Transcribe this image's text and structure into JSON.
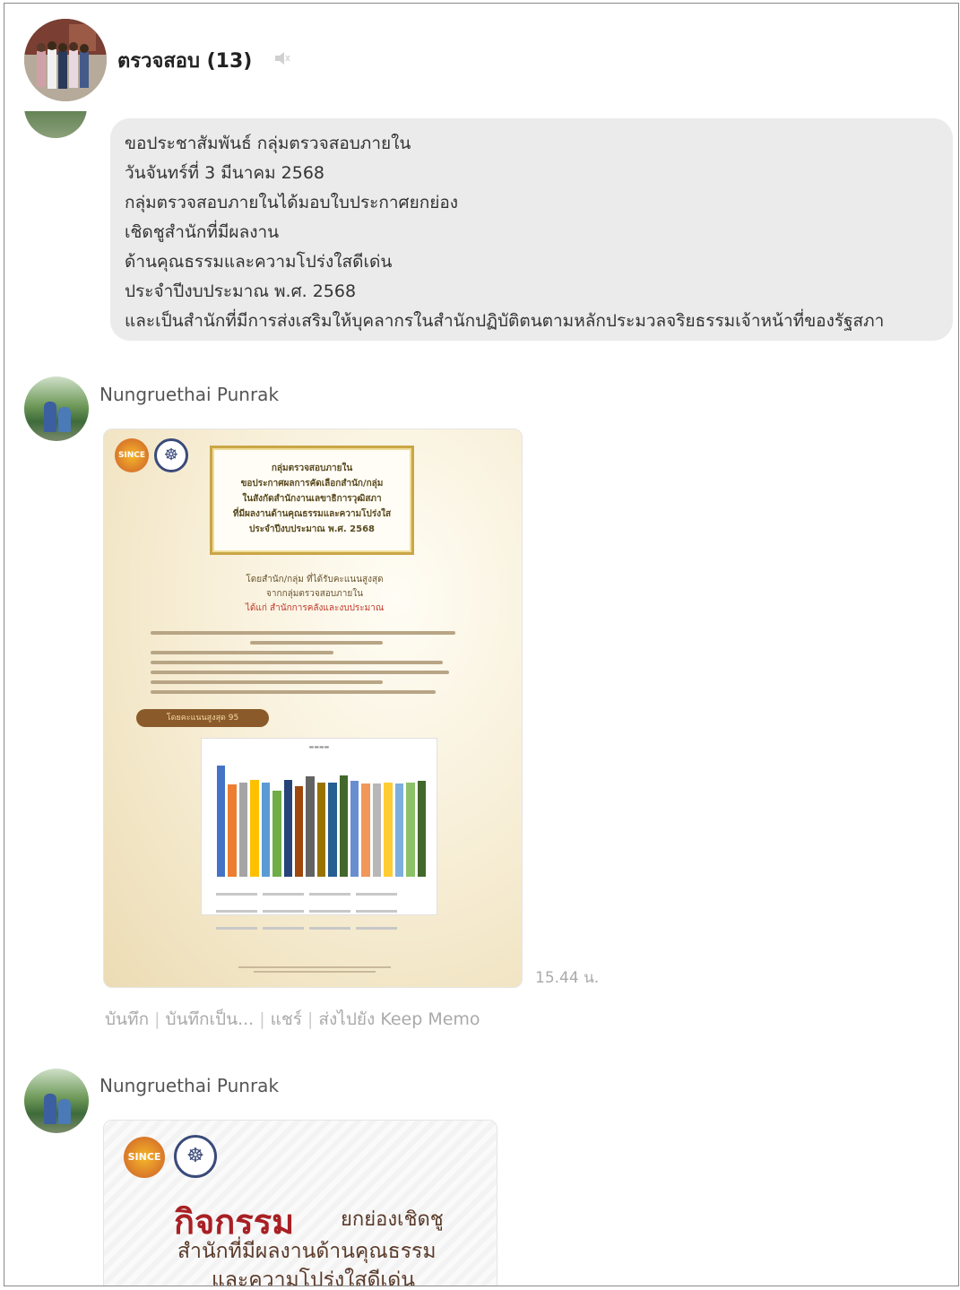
{
  "header": {
    "group_name": "ตรวจสอบ (13)"
  },
  "messages": [
    {
      "lines": [
        "ขอประชาสัมพันธ์  กลุ่มตรวจสอบภายใน",
        "วันจันทร์ที่ 3 มีนาคม 2568",
        "กลุ่มตรวจสอบภายในได้มอบใบประกาศยกย่อง",
        "เชิดชูสำนักที่มีผลงาน",
        "ด้านคุณธรรมและความโปร่งใสดีเด่น",
        "ประจำปีงบประมาณ พ.ศ. 2568",
        "และเป็นสำนักที่มีการส่งเสริมให้บุคลากรในสำนักปฏิบัติตนตามหลักประมวลจริยธรรมเจ้าหน้าที่ของรัฐสภา"
      ]
    },
    {
      "author": "Nungruethai Punrak",
      "timestamp": "15.44 น.",
      "poster": {
        "title_lines": [
          "กลุ่มตรวจสอบภายใน",
          "ขอประกาศผลการคัดเลือกสำนัก/กลุ่ม",
          "ในสังกัดสำนักงานเลขาธิการวุฒิสภา",
          "ที่มีผลงานด้านคุณธรรมและความโปร่งใส",
          "ประจำปีงบประมาณ พ.ศ. 2568"
        ],
        "sub_lines": [
          "โดยสำนัก/กลุ่ม ที่ได้รับคะแนนสูงสุด",
          "จากกลุ่มตรวจสอบภายใน",
          "ได้แก่ สำนักการคลังและงบประมาณ"
        ],
        "score_pill": "โดยคะแนนสูงสุด 95",
        "chart_values": [
          95,
          79,
          81,
          83,
          81,
          74,
          83,
          78,
          86,
          81,
          81,
          87,
          82,
          80,
          80,
          81,
          80,
          81,
          82
        ]
      },
      "actions": [
        "บันทึก",
        "บันทึกเป็น...",
        "แชร์",
        "ส่งไปยัง Keep Memo"
      ]
    },
    {
      "author": "Nungruethai Punrak",
      "poster": {
        "big": "กิจกรรม",
        "small": "ยกย่องเชิดชู",
        "line2": "สำนักที่มีผลงานด้านคุณธรรม",
        "line3": "และความโปร่งใสดีเด่น"
      }
    }
  ],
  "colors": {
    "bubble": "#ebebeb",
    "bars": [
      "#4472c4",
      "#ed7d31",
      "#a5a5a5",
      "#ffc000",
      "#5b9bd5",
      "#70ad47",
      "#264478",
      "#9e480e",
      "#636363",
      "#997300",
      "#255e91",
      "#43682b",
      "#698ed0",
      "#f1975a",
      "#b7b7b7",
      "#ffcd33",
      "#7cafdd",
      "#8cc168",
      "#43682b"
    ]
  }
}
